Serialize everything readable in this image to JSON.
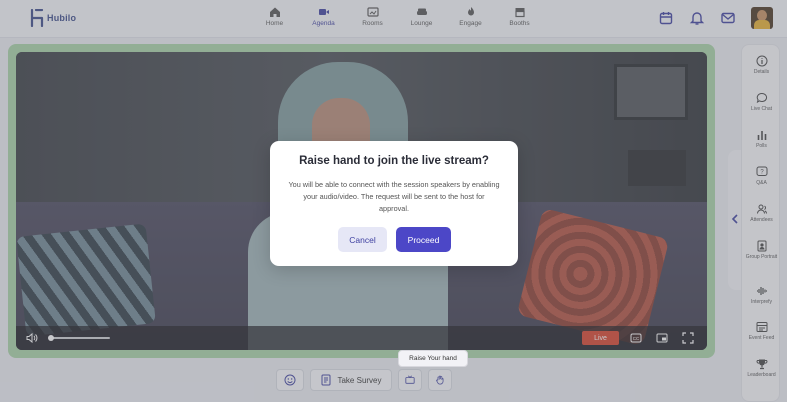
{
  "app": {
    "brand": "Hubilo"
  },
  "nav": [
    {
      "label": "Home",
      "icon": "home-icon"
    },
    {
      "label": "Agenda",
      "icon": "video-camera-icon",
      "active": true
    },
    {
      "label": "Rooms",
      "icon": "rooms-icon"
    },
    {
      "label": "Lounge",
      "icon": "lounge-icon"
    },
    {
      "label": "Engage",
      "icon": "engage-icon"
    },
    {
      "label": "Booths",
      "icon": "booths-icon"
    }
  ],
  "top_right": {
    "icons": [
      "calendar-icon",
      "bell-icon",
      "mail-icon",
      "avatar"
    ]
  },
  "player": {
    "live_label": "Live",
    "progress": 0.0
  },
  "side_rail": [
    {
      "label": "Details",
      "icon": "info-icon"
    },
    {
      "label": "Live Chat",
      "icon": "chat-icon"
    },
    {
      "label": "Polls",
      "icon": "polls-icon"
    },
    {
      "label": "Q&A",
      "icon": "qa-icon"
    },
    {
      "label": "Attendees",
      "icon": "attendees-icon"
    },
    {
      "label": "Group Portrait",
      "icon": "group-portrait-icon"
    },
    {
      "label": "Interprefy",
      "icon": "interprefy-icon"
    },
    {
      "label": "Event Feed",
      "icon": "event-feed-icon"
    },
    {
      "label": "Leaderboard",
      "icon": "trophy-icon"
    }
  ],
  "toolbar": {
    "survey_label": "Take Survey",
    "tooltip": "Raise Your hand"
  },
  "modal": {
    "title": "Raise hand to join the live stream?",
    "body": "You will be able to connect with the session speakers by enabling your audio/video. The request will be sent to the host for approval.",
    "cancel_label": "Cancel",
    "proceed_label": "Proceed"
  },
  "colors": {
    "accent": "#4c47c7",
    "brand": "#3d3fa0",
    "live": "#d9412b",
    "stage_border": "#a8d4a6"
  }
}
